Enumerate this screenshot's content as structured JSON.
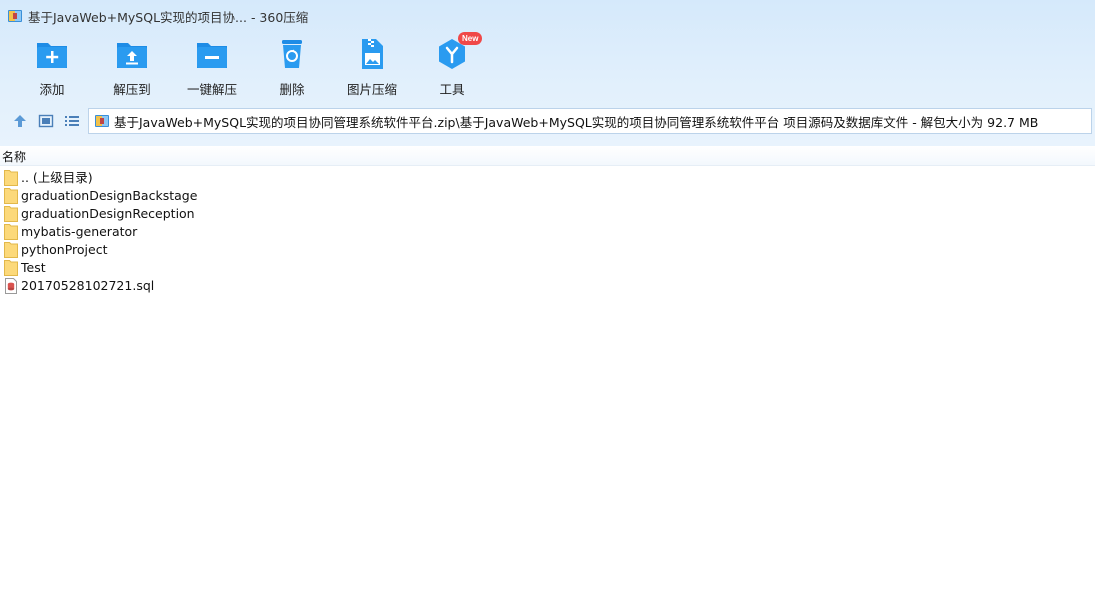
{
  "window": {
    "title": "基于JavaWeb+MySQL实现的项目协... - 360压缩"
  },
  "toolbar": {
    "items": [
      {
        "label": "添加",
        "icon": "add-folder-icon"
      },
      {
        "label": "解压到",
        "icon": "extract-to-icon"
      },
      {
        "label": "一键解压",
        "icon": "one-click-extract-icon"
      },
      {
        "label": "删除",
        "icon": "delete-trash-icon"
      },
      {
        "label": "图片压缩",
        "icon": "image-compress-icon"
      },
      {
        "label": "工具",
        "icon": "tools-icon",
        "badge": "New"
      }
    ]
  },
  "nav": {
    "up_icon": "up-arrow-icon",
    "view_thumbnail_icon": "view-thumbnail-icon",
    "view_list_icon": "view-list-icon",
    "path": "基于JavaWeb+MySQL实现的项目协同管理系统软件平台.zip\\基于JavaWeb+MySQL实现的项目协同管理系统软件平台 项目源码及数据库文件 - 解包大小为 92.7 MB"
  },
  "columns": {
    "name": "名称"
  },
  "files": [
    {
      "name": ".. (上级目录)",
      "type": "folder"
    },
    {
      "name": "graduationDesignBackstage",
      "type": "folder"
    },
    {
      "name": "graduationDesignReception",
      "type": "folder"
    },
    {
      "name": "mybatis-generator",
      "type": "folder"
    },
    {
      "name": "pythonProject",
      "type": "folder"
    },
    {
      "name": "Test",
      "type": "folder"
    },
    {
      "name": "20170528102721.sql",
      "type": "sql-file"
    }
  ],
  "colors": {
    "accent": "#1e8ce6",
    "header_bg": "#dbecfb",
    "folder": "#fcd97a",
    "badge": "#f04848"
  }
}
